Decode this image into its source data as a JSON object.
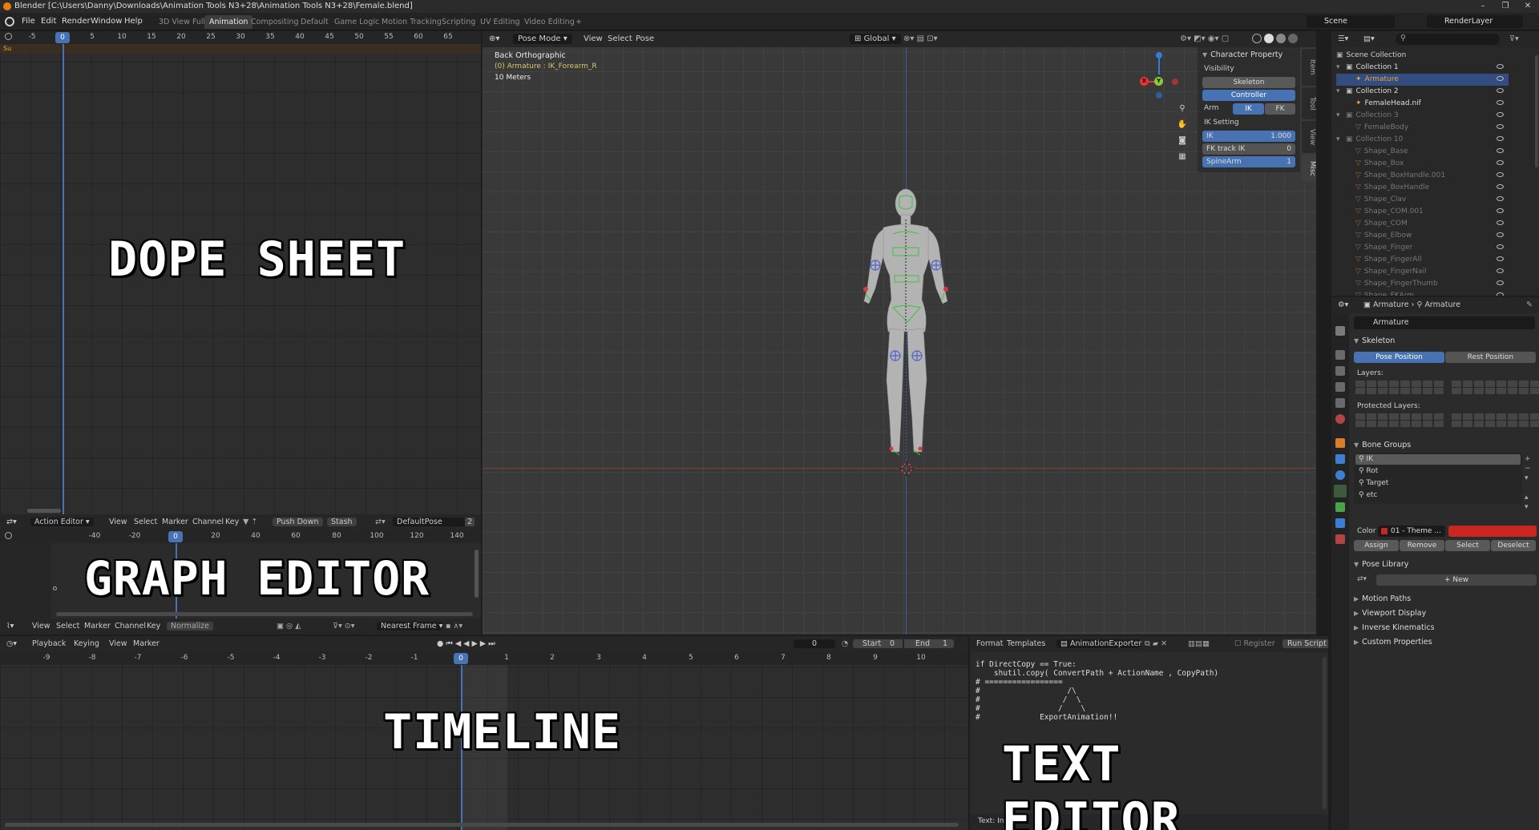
{
  "window": {
    "title": "Blender [C:\\Users\\Danny\\Downloads\\Animation Tools N3+28\\Animation Tools N3+28\\Female.blend]",
    "controls": [
      "–",
      "❐",
      "✕"
    ]
  },
  "menu": [
    "File",
    "Edit",
    "Render",
    "Window",
    "Help"
  ],
  "workspaces": [
    "3D View Full",
    "Animation",
    "Compositing",
    "Default",
    "Game Logic",
    "Motion Tracking",
    "Scripting",
    "UV Editing",
    "Video Editing",
    "+"
  ],
  "active_workspace": "Animation",
  "scene_name": "Scene",
  "render_layer": "RenderLayer",
  "dopesheet": {
    "ticks": [
      "-5",
      "0",
      "5",
      "10",
      "15",
      "20",
      "25",
      "30",
      "35",
      "40",
      "45",
      "50",
      "55",
      "60",
      "65"
    ],
    "current_frame": "0",
    "channel": "Su",
    "overlay_label": "DOPE SHEET",
    "header": {
      "mode": "Action Editor",
      "menus": [
        "View",
        "Select",
        "Marker",
        "Channel",
        "Key"
      ],
      "push_down": "Push Down",
      "stash": "Stash",
      "action": "DefaultPose",
      "users": "2"
    }
  },
  "graph": {
    "ticks": [
      "-40",
      "-20",
      "0",
      "20",
      "40",
      "60",
      "80",
      "100",
      "120",
      "140"
    ],
    "current_frame": "0",
    "overlay_label": "GRAPH EDITOR",
    "header": {
      "menus": [
        "View",
        "Select",
        "Marker",
        "Channel",
        "Key"
      ],
      "normalize": "Normalize",
      "snap": "Nearest Frame"
    }
  },
  "viewport": {
    "header": {
      "mode": "Pose Mode",
      "menus": [
        "View",
        "Select",
        "Pose"
      ],
      "orientation": "Global"
    },
    "view_name": "Back Orthographic",
    "active_object": "(0) Armature : IK_Forearm_R",
    "scale": "10 Meters",
    "gizmo": {
      "x": "X",
      "y": "Y"
    }
  },
  "n_panel": {
    "title": "Character Property",
    "visibility_label": "Visibility",
    "skeleton_btn": "Skeleton",
    "controller_btn": "Controller",
    "arm_label": "Arm",
    "ik_btn": "IK",
    "fk_btn": "FK",
    "ik_setting_label": "IK Setting",
    "fields": [
      {
        "label": "IK",
        "value": "1.000",
        "fill": 1.0
      },
      {
        "label": "FK track IK",
        "value": "0",
        "fill": 0.0
      },
      {
        "label": "SpineArm",
        "value": "1",
        "fill": 1.0
      }
    ],
    "tabs": [
      "Item",
      "Tool",
      "View",
      "Misc"
    ]
  },
  "outliner": {
    "root": "Scene Collection",
    "rows": [
      {
        "label": "Collection 1",
        "indent": 1,
        "type": "collection",
        "dim": false
      },
      {
        "label": "Armature",
        "indent": 2,
        "type": "armature",
        "dim": false,
        "selected": true
      },
      {
        "label": "Collection 2",
        "indent": 1,
        "type": "collection",
        "dim": false
      },
      {
        "label": "FemaleHead.nif",
        "indent": 2,
        "type": "armature",
        "dim": false
      },
      {
        "label": "Collection 3",
        "indent": 1,
        "type": "collection",
        "dim": true
      },
      {
        "label": "FemaleBody",
        "indent": 2,
        "type": "mesh",
        "dim": true
      },
      {
        "label": "Collection 10",
        "indent": 1,
        "type": "collection",
        "dim": true
      },
      {
        "label": "Shape_Base",
        "indent": 2,
        "type": "mesh",
        "dim": true
      },
      {
        "label": "Shape_Box",
        "indent": 2,
        "type": "mesh",
        "dim": true
      },
      {
        "label": "Shape_BoxHandle.001",
        "indent": 2,
        "type": "mesh",
        "dim": true
      },
      {
        "label": "Shape_BoxHandle",
        "indent": 2,
        "type": "mesh",
        "dim": true
      },
      {
        "label": "Shape_Clav",
        "indent": 2,
        "type": "mesh",
        "dim": true
      },
      {
        "label": "Shape_COM.001",
        "indent": 2,
        "type": "mesh",
        "dim": true
      },
      {
        "label": "Shape_COM",
        "indent": 2,
        "type": "mesh",
        "dim": true
      },
      {
        "label": "Shape_Elbow",
        "indent": 2,
        "type": "mesh",
        "dim": true
      },
      {
        "label": "Shape_Finger",
        "indent": 2,
        "type": "mesh",
        "dim": true
      },
      {
        "label": "Shape_FingerAll",
        "indent": 2,
        "type": "mesh",
        "dim": true
      },
      {
        "label": "Shape_FingerNail",
        "indent": 2,
        "type": "mesh",
        "dim": true
      },
      {
        "label": "Shape_FingerThumb",
        "indent": 2,
        "type": "mesh",
        "dim": true
      },
      {
        "label": "Shape_FKArm",
        "indent": 2,
        "type": "mesh",
        "dim": true
      }
    ]
  },
  "properties": {
    "breadcrumb": [
      "Armature",
      "Armature"
    ],
    "datablock": "Armature",
    "skeleton_label": "Skeleton",
    "pose_position": "Pose Position",
    "rest_position": "Rest Position",
    "layers_label": "Layers:",
    "protected_layers_label": "Protected Layers:",
    "bone_groups_label": "Bone Groups",
    "bone_groups": [
      "IK",
      "Rot",
      "Target",
      "etc"
    ],
    "color_label": "Color",
    "color_value": "01 - Theme ...",
    "color_swatch": "#c9261f",
    "assign": "Assign",
    "remove": "Remove",
    "select": "Select",
    "deselect": "Deselect",
    "pose_library_label": "Pose Library",
    "new_btn": "New",
    "sections": [
      "Motion Paths",
      "Viewport Display",
      "Inverse Kinematics",
      "Custom Properties"
    ]
  },
  "timeline": {
    "menus": [
      "Playback",
      "Keying",
      "View",
      "Marker"
    ],
    "current": "0",
    "start_label": "Start",
    "start": "0",
    "end_label": "End",
    "end": "1",
    "ticks": [
      "-9",
      "-8",
      "-7",
      "-6",
      "-5",
      "-4",
      "-3",
      "-2",
      "-1",
      "0",
      "1",
      "2",
      "3",
      "4",
      "5",
      "6",
      "7",
      "8",
      "9",
      "10"
    ],
    "overlay_label": "TIMELINE"
  },
  "text_editor": {
    "menus": [
      "Format",
      "Templates"
    ],
    "file": "AnimationExporter",
    "register": "Register",
    "run_script": "Run Script",
    "code": "if DirectCopy == True:\n    shutil.copy( ConvertPath + ActionName , CopyPath)\n# =================\n#                   /\\\n#                  /  \\\n#                 /    \\\n#             ExportAnimation!!",
    "status": "Text: Internal",
    "overlay_label": "TEXT EDITOR"
  },
  "colors": {
    "accent": "#4772b3",
    "selected_row": "#334d80",
    "active_tab": "#3d3d3d"
  }
}
